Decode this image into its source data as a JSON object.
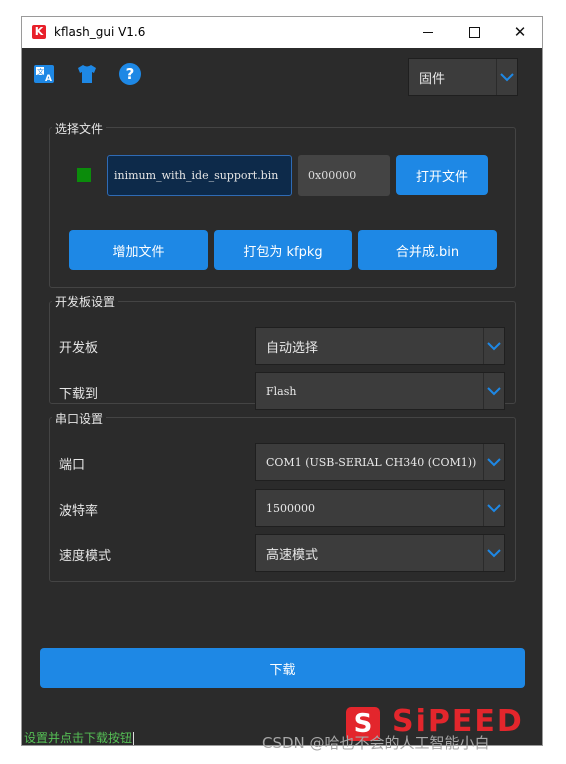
{
  "window": {
    "title": "kflash_gui V1.6",
    "logo_letter": "K"
  },
  "toolbar": {
    "mode_select": "固件"
  },
  "file_group": {
    "title": "选择文件",
    "file_path": "inimum_with_ide_support.bin",
    "address": "0x00000",
    "open_file_label": "打开文件",
    "add_file_label": "增加文件",
    "pack_label": "打包为 kfpkg",
    "merge_label": "合并成.bin"
  },
  "board_group": {
    "title": "开发板设置",
    "board_label": "开发板",
    "board_value": "自动选择",
    "download_to_label": "下载到",
    "download_to_value": "Flash"
  },
  "serial_group": {
    "title": "串口设置",
    "port_label": "端口",
    "port_value": "COM1 (USB-SERIAL CH340 (COM1))",
    "baud_label": "波特率",
    "baud_value": "1500000",
    "speed_label": "速度模式",
    "speed_value": "高速模式"
  },
  "download_label": "下载",
  "status_text": "设置并点击下载按钮",
  "brand": {
    "mark": "S",
    "word": "SiPEED"
  },
  "watermark": "CSDN @哈也不会的人工智能小白",
  "colors": {
    "accent": "#1e88e5",
    "background": "#2b2b2b",
    "status_green": "#0b8c0b",
    "brand_red": "#e3262c"
  }
}
